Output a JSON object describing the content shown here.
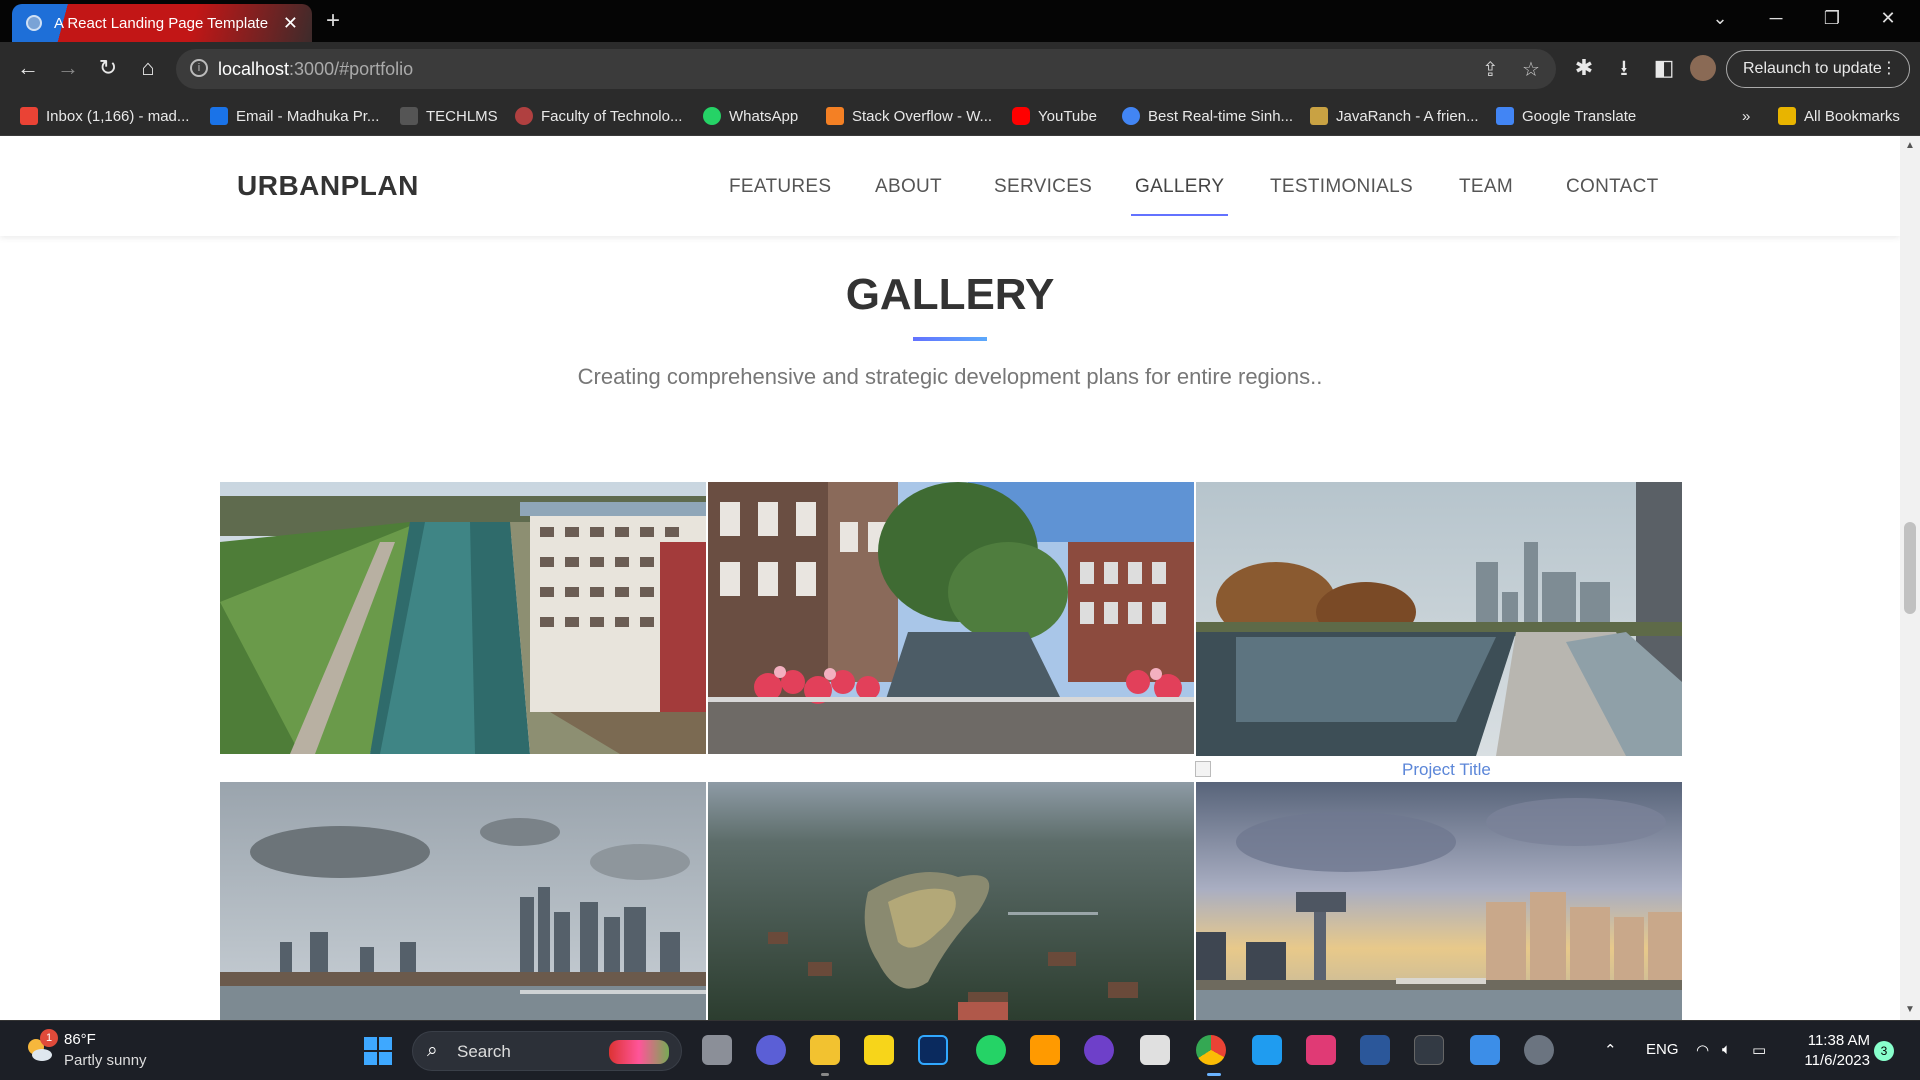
{
  "browser": {
    "tab_title": "A React Landing Page Template",
    "url_host": "localhost",
    "url_rest": ":3000/#portfolio",
    "relaunch_label": "Relaunch to update",
    "bookmarks": [
      {
        "label": "Inbox (1,166) - mad...",
        "icon": "gmail-icon",
        "color": "#ea4335"
      },
      {
        "label": "Email - Madhuka Pr...",
        "icon": "outlook-icon",
        "color": "#1a73e8"
      },
      {
        "label": "TECHLMS",
        "icon": "moodle-icon",
        "color": "#555555"
      },
      {
        "label": "Faculty of Technolo...",
        "icon": "university-icon",
        "color": "#b04040"
      },
      {
        "label": "WhatsApp",
        "icon": "whatsapp-icon",
        "color": "#25d366"
      },
      {
        "label": "Stack Overflow - W...",
        "icon": "stackoverflow-icon",
        "color": "#f48024"
      },
      {
        "label": "YouTube",
        "icon": "youtube-icon",
        "color": "#ff0000"
      },
      {
        "label": "Best Real-time Sinh...",
        "icon": "google-icon",
        "color": "#4285f4"
      },
      {
        "label": "JavaRanch - A frien...",
        "icon": "javaranch-icon",
        "color": "#c9a243"
      },
      {
        "label": "Google Translate",
        "icon": "translate-icon",
        "color": "#4285f4"
      }
    ],
    "all_bookmarks_label": "All Bookmarks"
  },
  "site": {
    "brand": "URBANPLAN",
    "nav": [
      "FEATURES",
      "ABOUT",
      "SERVICES",
      "GALLERY",
      "TESTIMONIALS",
      "TEAM",
      "CONTACT"
    ],
    "active_nav": "GALLERY",
    "accent": "#6372ff",
    "gallery": {
      "title": "GALLERY",
      "subtitle": "Creating comprehensive and strategic development plans for entire regions..",
      "broken_image_alt": "Project Title"
    }
  },
  "taskbar": {
    "weather_temp": "86°F",
    "weather_desc": "Partly sunny",
    "weather_badge": "1",
    "search_label": "Search",
    "language": "ENG",
    "time": "11:38 AM",
    "date": "11/6/2023",
    "notifications": "3"
  }
}
